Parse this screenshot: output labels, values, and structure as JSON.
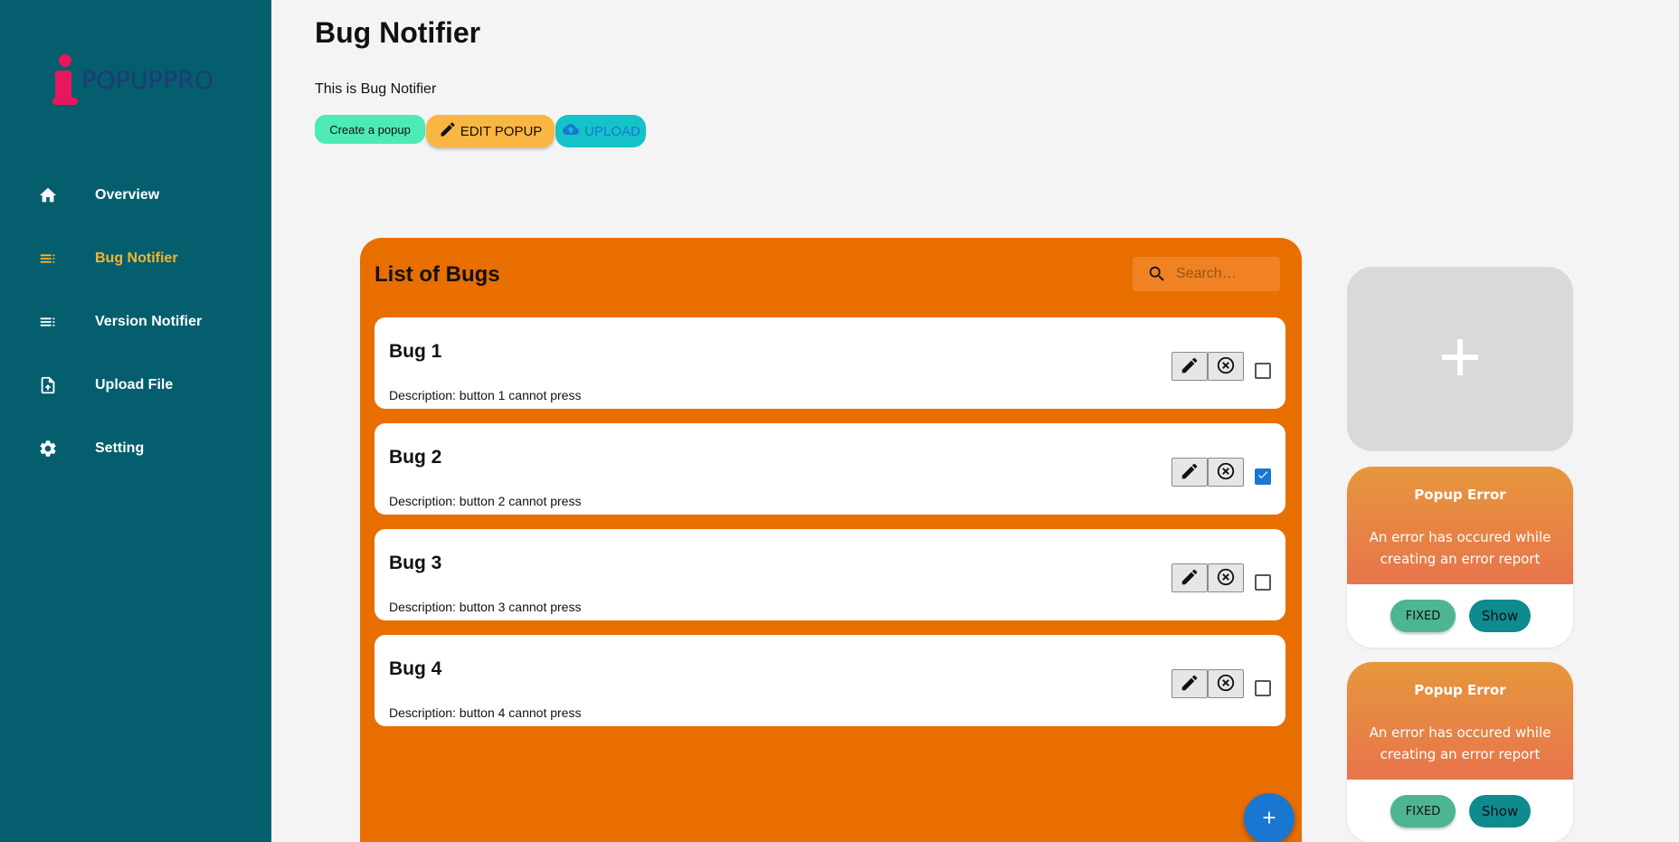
{
  "brand": {
    "logo_text": "POPUPPRO"
  },
  "sidebar": {
    "items": [
      {
        "label": "Overview",
        "icon": "home-icon",
        "active": false
      },
      {
        "label": "Bug Notifier",
        "icon": "list-icon",
        "active": true
      },
      {
        "label": "Version Notifier",
        "icon": "list-icon",
        "active": false
      },
      {
        "label": "Upload File",
        "icon": "upload-file-icon",
        "active": false
      },
      {
        "label": "Setting",
        "icon": "gear-icon",
        "active": false
      }
    ]
  },
  "header": {
    "title": "Bug Notifier",
    "subtitle": "This is Bug Notifier",
    "buttons": {
      "create": "Create a popup",
      "edit": "EDIT POPUP",
      "upload": "UPLOAD"
    }
  },
  "bug_list": {
    "title": "List of Bugs",
    "search_placeholder": "Search…",
    "bugs": [
      {
        "title": "Bug 1",
        "description": "Description: button 1 cannot press",
        "checked": false
      },
      {
        "title": "Bug 2",
        "description": "Description: button 2 cannot press",
        "checked": true
      },
      {
        "title": "Bug 3",
        "description": "Description: button 3 cannot press",
        "checked": false
      },
      {
        "title": "Bug 4",
        "description": "Description: button 4 cannot press",
        "checked": false
      }
    ]
  },
  "popups": [
    {
      "title": "Popup Error",
      "message": "An error has occured while creating an error report",
      "fixed_label": "FIXED",
      "show_label": "Show"
    },
    {
      "title": "Popup Error",
      "message": "An error has occured while creating an error report",
      "fixed_label": "FIXED",
      "show_label": "Show"
    }
  ],
  "colors": {
    "sidebar": "#045e6e",
    "accent_active": "#f7b52a",
    "panel": "#e86e00",
    "fab": "#1977d2",
    "create_button": "#4deab4",
    "edit_button": "#f9b643",
    "upload_button": "#14c3c8"
  }
}
